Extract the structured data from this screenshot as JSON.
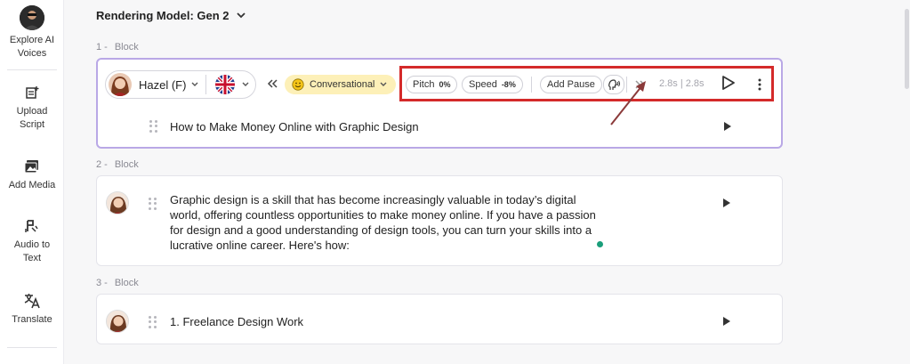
{
  "sidebar": {
    "items": [
      {
        "label": "Explore AI Voices",
        "icon": "user-avatar-icon"
      },
      {
        "label": "Upload Script",
        "icon": "upload-script-icon"
      },
      {
        "label": "Add Media",
        "icon": "add-media-icon"
      },
      {
        "label": "Audio to Text",
        "icon": "audio-to-text-icon"
      },
      {
        "label": "Translate",
        "icon": "translate-icon"
      }
    ]
  },
  "header": {
    "model_label": "Rendering Model: Gen 2"
  },
  "blocks": [
    {
      "number": "1 -",
      "label": "Block",
      "voice": "Hazel (F)",
      "tone": "Conversational",
      "pitch_label": "Pitch",
      "pitch_value": "0%",
      "speed_label": "Speed",
      "speed_value": "-8%",
      "pause_label": "Add Pause",
      "timing": "2.8s | 2.8s",
      "text": "How to Make Money Online with Graphic Design"
    },
    {
      "number": "2 -",
      "label": "Block",
      "lines": [
        "Graphic design is a skill that has become increasingly valuable in today’s digital",
        "world, offering countless opportunities to make money online. If you have a passion",
        "for design and a good understanding of design tools, you can turn your skills into a",
        "lucrative online career. Here's how:"
      ]
    },
    {
      "number": "3 -",
      "label": "Block",
      "text": "1. Freelance Design Work"
    }
  ],
  "colors": {
    "accent_border": "#b9a8e6",
    "highlight_box": "#d42a2a",
    "annotation_arrow": "#8b3a3a",
    "tone_bg": "#fdf0b8"
  }
}
